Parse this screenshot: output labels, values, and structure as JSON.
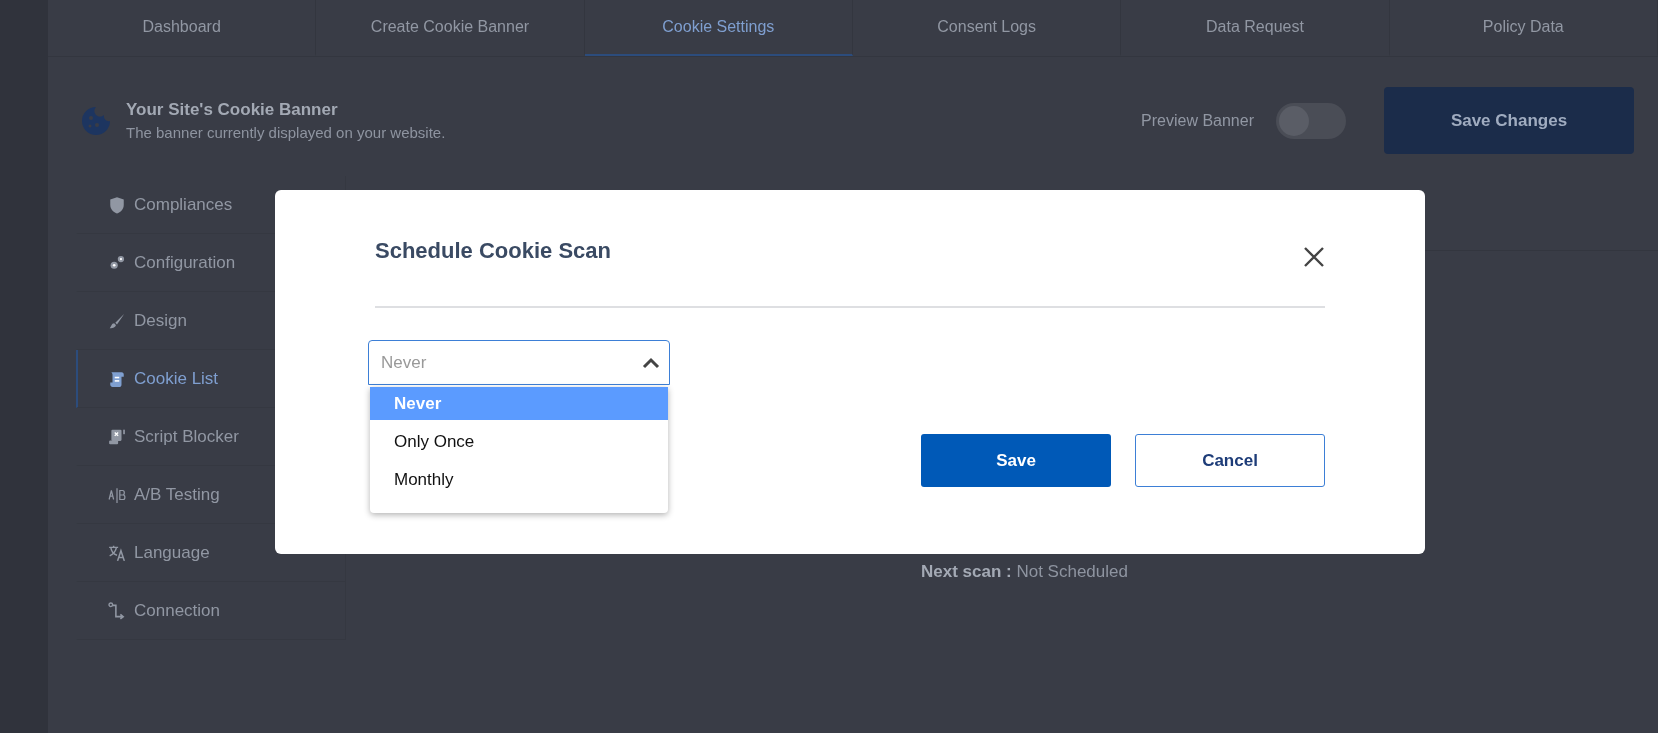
{
  "tabs": [
    {
      "label": "Dashboard",
      "selected": false
    },
    {
      "label": "Create Cookie Banner",
      "selected": false
    },
    {
      "label": "Cookie Settings",
      "selected": true
    },
    {
      "label": "Consent Logs",
      "selected": false
    },
    {
      "label": "Data Request",
      "selected": false
    },
    {
      "label": "Policy Data",
      "selected": false
    }
  ],
  "header": {
    "title": "Your Site's Cookie Banner",
    "subtitle": "The banner currently displayed on your website.",
    "preview": {
      "label": "Preview Banner",
      "on": false
    },
    "save_button": "Save Changes"
  },
  "sidebar": {
    "items": [
      {
        "label": "Compliances",
        "selected": false
      },
      {
        "label": "Configuration",
        "selected": false
      },
      {
        "label": "Design",
        "selected": false
      },
      {
        "label": "Cookie List",
        "selected": true
      },
      {
        "label": "Script Blocker",
        "selected": false
      },
      {
        "label": "A/B Testing",
        "selected": false
      },
      {
        "label": "Language",
        "selected": false
      },
      {
        "label": "Connection",
        "selected": false
      }
    ]
  },
  "next_scan": {
    "label": "Next scan :",
    "value": "Not Scheduled"
  },
  "modal": {
    "title": "Schedule Cookie Scan",
    "select": {
      "placeholder": "Never",
      "expanded": true,
      "options": [
        {
          "label": "Never",
          "selected": true
        },
        {
          "label": "Only Once",
          "selected": false
        },
        {
          "label": "Monthly",
          "selected": false
        }
      ]
    },
    "buttons": [
      {
        "label": "Save",
        "kind": "primary"
      },
      {
        "label": "Cancel",
        "kind": "secondary"
      }
    ]
  }
}
